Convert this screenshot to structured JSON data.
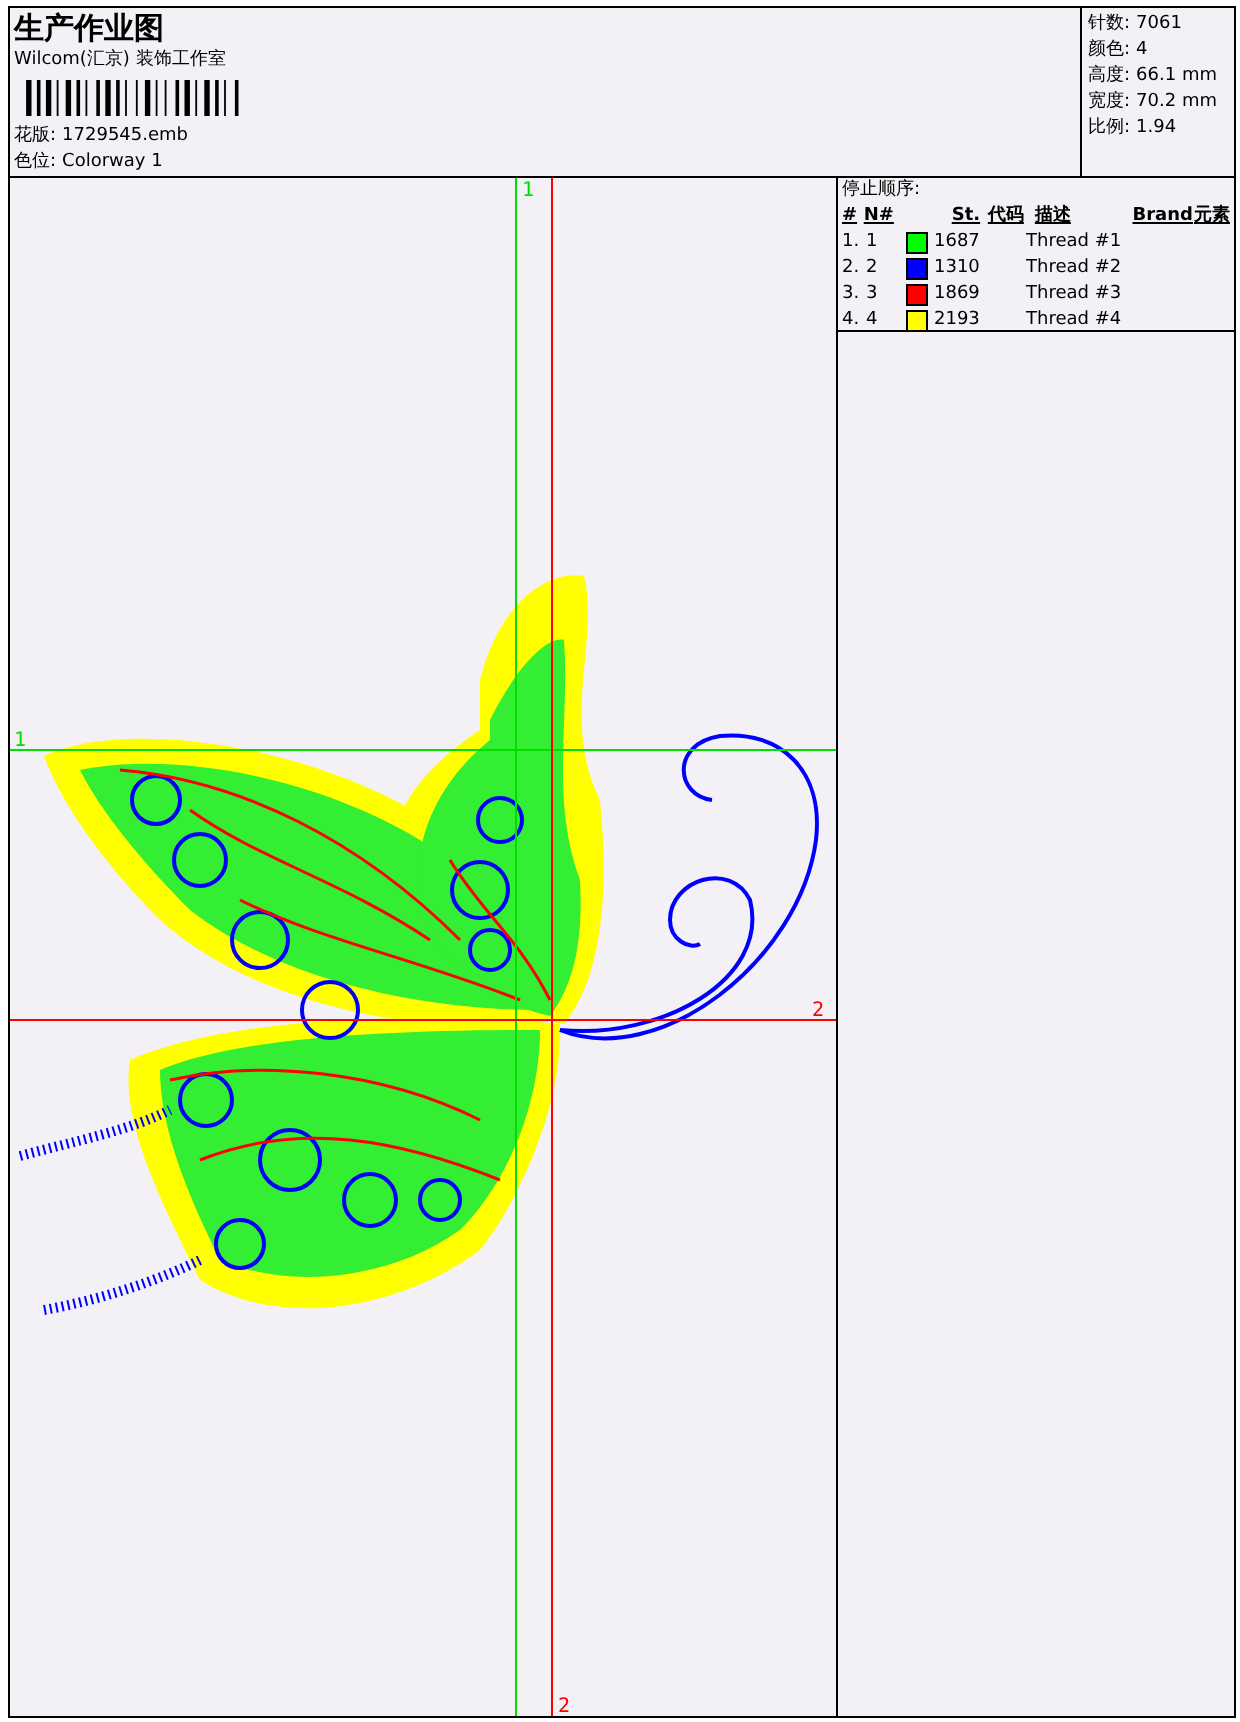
{
  "title": "生产作业图",
  "company": "Wilcom(汇京) 装饰工作室",
  "design_file": {
    "label": "花版:",
    "value": "1729545.emb"
  },
  "colorway": {
    "label": "色位:",
    "value": "Colorway 1"
  },
  "stats": [
    {
      "label": "针数:",
      "value": "7061"
    },
    {
      "label": "颜色:",
      "value": "4"
    },
    {
      "label": "高度:",
      "value": "66.1 mm"
    },
    {
      "label": "宽度:",
      "value": "70.2 mm"
    },
    {
      "label": "比例:",
      "value": "1.94"
    }
  ],
  "guides": [
    {
      "kind": "vertical",
      "label": "1",
      "color": "#00e000"
    },
    {
      "kind": "horizontal",
      "label": "1",
      "color": "#00e000"
    },
    {
      "kind": "horizontal",
      "label": "2",
      "color": "#ff0000"
    },
    {
      "kind": "vertical",
      "label": "2",
      "color": "#ff0000"
    }
  ],
  "stop_sequence": {
    "title": "停止顺序:",
    "columns": [
      "#",
      "N#",
      "St.",
      "代码",
      "描述",
      "Brand",
      "元素"
    ],
    "rows": [
      {
        "index": "1.",
        "number": "1",
        "color": "#00ff00",
        "stitches": "1687",
        "description": "Thread #1"
      },
      {
        "index": "2.",
        "number": "2",
        "color": "#0000ff",
        "stitches": "1310",
        "description": "Thread #2"
      },
      {
        "index": "3.",
        "number": "3",
        "color": "#ff0000",
        "stitches": "1869",
        "description": "Thread #3"
      },
      {
        "index": "4.",
        "number": "4",
        "color": "#ffff00",
        "stitches": "2193",
        "description": "Thread #4"
      }
    ]
  }
}
